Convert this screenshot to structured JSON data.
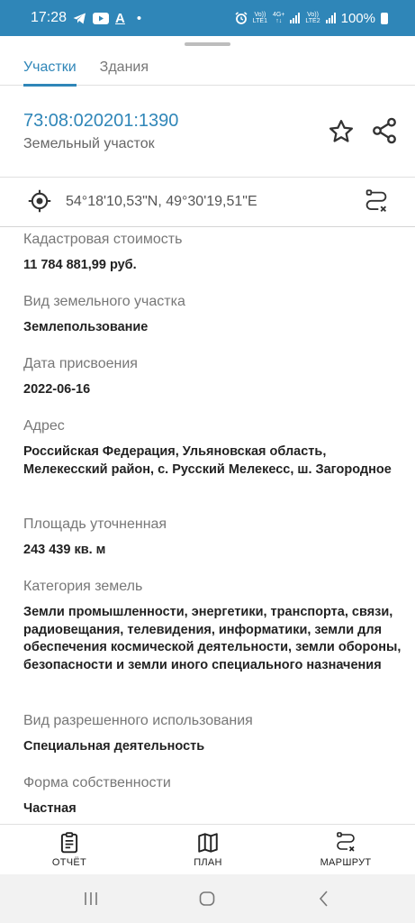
{
  "status_bar": {
    "time": "17:28",
    "notif_letter": "A",
    "dot": "•",
    "sim1_top": "Vo))",
    "sim1_bottom": "LTE1",
    "net_top": "4G+",
    "net_bottom": "↑↓",
    "sim2_top": "Vo))",
    "sim2_bottom": "LTE2",
    "battery": "100%"
  },
  "tabs": [
    {
      "label": "Участки",
      "active": true
    },
    {
      "label": "Здания",
      "active": false
    }
  ],
  "header": {
    "cadastral_number": "73:08:020201:1390",
    "object_type": "Земельный участок"
  },
  "coordinates": "54°18'10,53\"N, 49°30'19,51\"E",
  "fields": [
    {
      "label": "Кадастровая стоимость",
      "value": "11 784 881,99 руб."
    },
    {
      "label": "Вид земельного участка",
      "value": "Землепользование"
    },
    {
      "label": "Дата присвоения",
      "value": "2022-06-16"
    },
    {
      "label": "Адрес",
      "value": "Российская Федерация, Ульяновская область, Мелекесский район, с. Русский Мелекесс, ш. Загородное"
    },
    {
      "label": "Площадь уточненная",
      "value": "243 439 кв. м"
    },
    {
      "label": "Категория земель",
      "value": "Земли промышленности, энергетики, транспорта, связи, радиовещания, телевидения, информатики, земли для обеспечения космической деятельности, земли обороны, безопасности и земли иного специального назначения"
    },
    {
      "label": "Вид разрешенного использования",
      "value": "Специальная деятельность"
    },
    {
      "label": "Форма собственности",
      "value": "Частная"
    }
  ],
  "bottom_nav": [
    {
      "label": "ОТЧЁТ",
      "icon": "report-icon"
    },
    {
      "label": "ПЛАН",
      "icon": "map-icon"
    },
    {
      "label": "МАРШРУТ",
      "icon": "route-icon"
    }
  ],
  "colors": {
    "accent": "#2f86b8",
    "label": "#777777",
    "value": "#222222"
  }
}
